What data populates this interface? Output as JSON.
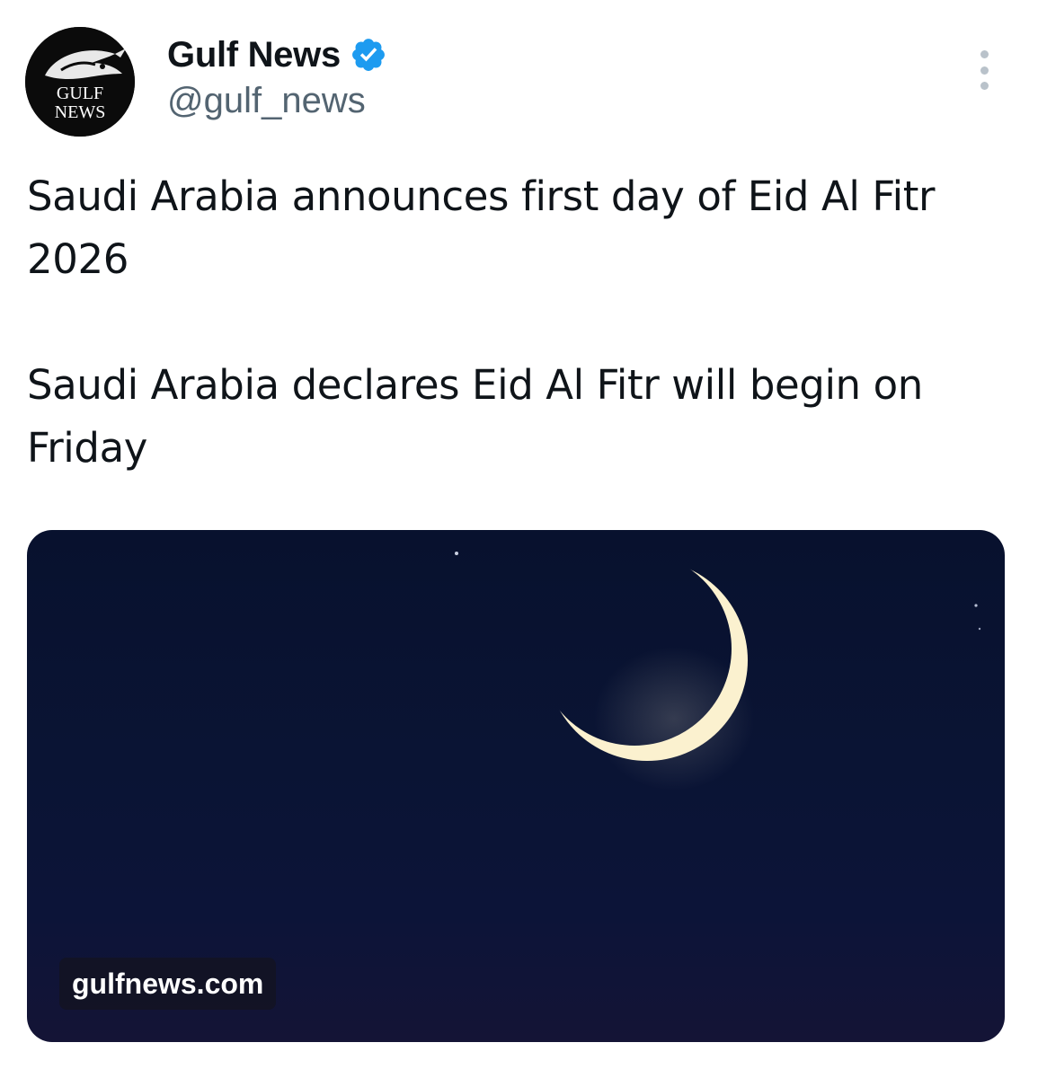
{
  "author": {
    "name": "Gulf News",
    "handle": "@gulf_news",
    "verified": true,
    "avatar_text_line1": "GULF",
    "avatar_text_line2": "NEWS"
  },
  "tweet": {
    "paragraphs": [
      "Saudi Arabia announces first day of Eid Al Fitr 2026",
      "Saudi Arabia declares Eid Al Fitr will begin on Friday"
    ]
  },
  "media": {
    "domain": "gulfnews.com",
    "image_subject": "crescent-moon-night-sky"
  },
  "icons": {
    "verified": "verified-badge-icon",
    "more": "more-options-icon"
  },
  "colors": {
    "verified_blue": "#1d9bf0",
    "handle_gray": "#536471",
    "text": "#0f1419"
  }
}
